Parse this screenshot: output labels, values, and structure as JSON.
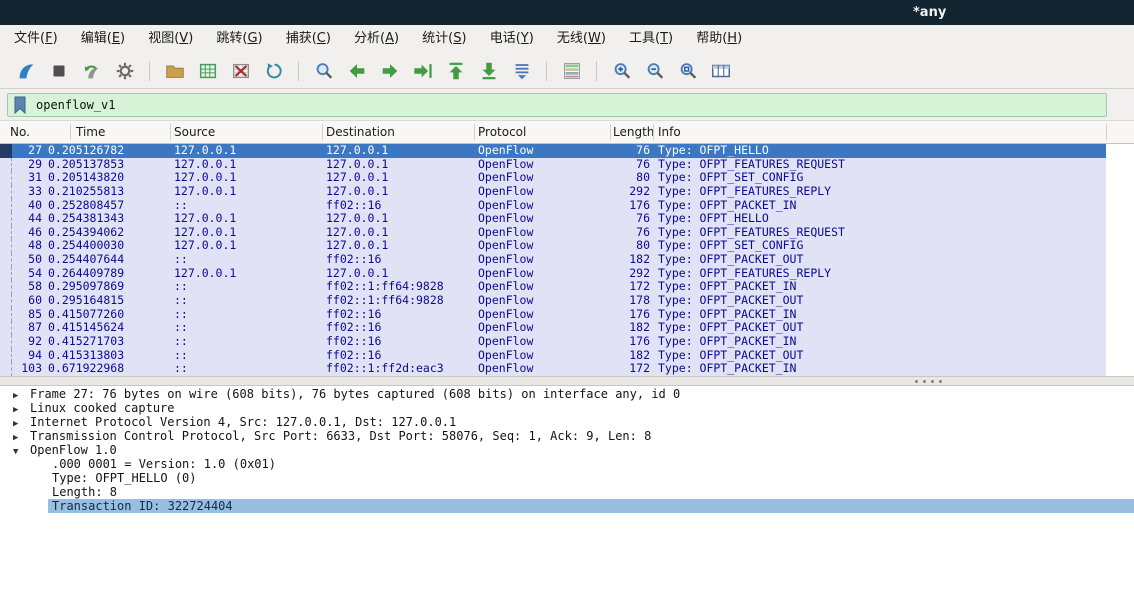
{
  "window": {
    "title": "*any"
  },
  "menu": {
    "items": [
      {
        "pre": "文件(",
        "key": "F",
        "post": ")"
      },
      {
        "pre": "编辑(",
        "key": "E",
        "post": ")"
      },
      {
        "pre": "视图(",
        "key": "V",
        "post": ")"
      },
      {
        "pre": "跳转(",
        "key": "G",
        "post": ")"
      },
      {
        "pre": "捕获(",
        "key": "C",
        "post": ")"
      },
      {
        "pre": "分析(",
        "key": "A",
        "post": ")"
      },
      {
        "pre": "统计(",
        "key": "S",
        "post": ")"
      },
      {
        "pre": "电话(",
        "key": "Y",
        "post": ")"
      },
      {
        "pre": "无线(",
        "key": "W",
        "post": ")"
      },
      {
        "pre": "工具(",
        "key": "T",
        "post": ")"
      },
      {
        "pre": "帮助(",
        "key": "H",
        "post": ")"
      }
    ]
  },
  "toolbar": {
    "icons": [
      "start-capture",
      "stop-capture",
      "restart-capture",
      "capture-options",
      "open-capture-file",
      "save-capture-file",
      "close-capture-file",
      "reload-capture-file",
      "find-packet",
      "go-back",
      "go-forward",
      "go-to-packet",
      "go-to-first-packet",
      "go-to-last-packet",
      "auto-scroll",
      "colorize-packets",
      "zoom-in",
      "zoom-out",
      "zoom-100",
      "resize-columns"
    ]
  },
  "filter": {
    "value": "openflow_v1"
  },
  "packet_list": {
    "columns": [
      "No.",
      "Time",
      "Source",
      "Destination",
      "Protocol",
      "Length",
      "Info"
    ],
    "rows": [
      {
        "no": "27",
        "time": "0.205126782",
        "source": "127.0.0.1",
        "destination": "127.0.0.1",
        "protocol": "OpenFlow",
        "length": "76",
        "info": "Type: OFPT_HELLO",
        "selected": true
      },
      {
        "no": "29",
        "time": "0.205137853",
        "source": "127.0.0.1",
        "destination": "127.0.0.1",
        "protocol": "OpenFlow",
        "length": "76",
        "info": "Type: OFPT_FEATURES_REQUEST"
      },
      {
        "no": "31",
        "time": "0.205143820",
        "source": "127.0.0.1",
        "destination": "127.0.0.1",
        "protocol": "OpenFlow",
        "length": "80",
        "info": "Type: OFPT_SET_CONFIG"
      },
      {
        "no": "33",
        "time": "0.210255813",
        "source": "127.0.0.1",
        "destination": "127.0.0.1",
        "protocol": "OpenFlow",
        "length": "292",
        "info": "Type: OFPT_FEATURES_REPLY"
      },
      {
        "no": "40",
        "time": "0.252808457",
        "source": "::",
        "destination": "ff02::16",
        "protocol": "OpenFlow",
        "length": "176",
        "info": "Type: OFPT_PACKET_IN"
      },
      {
        "no": "44",
        "time": "0.254381343",
        "source": "127.0.0.1",
        "destination": "127.0.0.1",
        "protocol": "OpenFlow",
        "length": "76",
        "info": "Type: OFPT_HELLO"
      },
      {
        "no": "46",
        "time": "0.254394062",
        "source": "127.0.0.1",
        "destination": "127.0.0.1",
        "protocol": "OpenFlow",
        "length": "76",
        "info": "Type: OFPT_FEATURES_REQUEST"
      },
      {
        "no": "48",
        "time": "0.254400030",
        "source": "127.0.0.1",
        "destination": "127.0.0.1",
        "protocol": "OpenFlow",
        "length": "80",
        "info": "Type: OFPT_SET_CONFIG"
      },
      {
        "no": "50",
        "time": "0.254407644",
        "source": "::",
        "destination": "ff02::16",
        "protocol": "OpenFlow",
        "length": "182",
        "info": "Type: OFPT_PACKET_OUT"
      },
      {
        "no": "54",
        "time": "0.264409789",
        "source": "127.0.0.1",
        "destination": "127.0.0.1",
        "protocol": "OpenFlow",
        "length": "292",
        "info": "Type: OFPT_FEATURES_REPLY"
      },
      {
        "no": "58",
        "time": "0.295097869",
        "source": "::",
        "destination": "ff02::1:ff64:9828",
        "protocol": "OpenFlow",
        "length": "172",
        "info": "Type: OFPT_PACKET_IN"
      },
      {
        "no": "60",
        "time": "0.295164815",
        "source": "::",
        "destination": "ff02::1:ff64:9828",
        "protocol": "OpenFlow",
        "length": "178",
        "info": "Type: OFPT_PACKET_OUT"
      },
      {
        "no": "85",
        "time": "0.415077260",
        "source": "::",
        "destination": "ff02::16",
        "protocol": "OpenFlow",
        "length": "176",
        "info": "Type: OFPT_PACKET_IN"
      },
      {
        "no": "87",
        "time": "0.415145624",
        "source": "::",
        "destination": "ff02::16",
        "protocol": "OpenFlow",
        "length": "182",
        "info": "Type: OFPT_PACKET_OUT"
      },
      {
        "no": "92",
        "time": "0.415271703",
        "source": "::",
        "destination": "ff02::16",
        "protocol": "OpenFlow",
        "length": "176",
        "info": "Type: OFPT_PACKET_IN"
      },
      {
        "no": "94",
        "time": "0.415313803",
        "source": "::",
        "destination": "ff02::16",
        "protocol": "OpenFlow",
        "length": "182",
        "info": "Type: OFPT_PACKET_OUT"
      },
      {
        "no": "103",
        "time": "0.671922968",
        "source": "::",
        "destination": "ff02::1:ff2d:eac3",
        "protocol": "OpenFlow",
        "length": "172",
        "info": "Type: OFPT_PACKET_IN"
      }
    ]
  },
  "details": {
    "lines": [
      {
        "arrow": "collapsed",
        "indent": 0,
        "text": "Frame 27: 76 bytes on wire (608 bits), 76 bytes captured (608 bits) on interface any, id 0"
      },
      {
        "arrow": "collapsed",
        "indent": 0,
        "text": "Linux cooked capture"
      },
      {
        "arrow": "collapsed",
        "indent": 0,
        "text": "Internet Protocol Version 4, Src: 127.0.0.1, Dst: 127.0.0.1"
      },
      {
        "arrow": "collapsed",
        "indent": 0,
        "text": "Transmission Control Protocol, Src Port: 6633, Dst Port: 58076, Seq: 1, Ack: 9, Len: 8"
      },
      {
        "arrow": "expanded",
        "indent": 0,
        "text": "OpenFlow 1.0"
      },
      {
        "arrow": null,
        "indent": 1,
        "text": ".000 0001 = Version: 1.0 (0x01)"
      },
      {
        "arrow": null,
        "indent": 1,
        "text": "Type: OFPT_HELLO (0)"
      },
      {
        "arrow": null,
        "indent": 1,
        "text": "Length: 8"
      },
      {
        "arrow": null,
        "indent": 1,
        "text": "Transaction ID: 322724404",
        "selected": true
      }
    ]
  },
  "colors": {
    "titlebar_bg": "#132531",
    "filter_bg": "#d7f2d7",
    "row_bg": "#e2e2f6",
    "row_text": "#0a0a96",
    "selected_row_bg": "#3c77c3",
    "detail_selected_bg": "#9abedd"
  }
}
